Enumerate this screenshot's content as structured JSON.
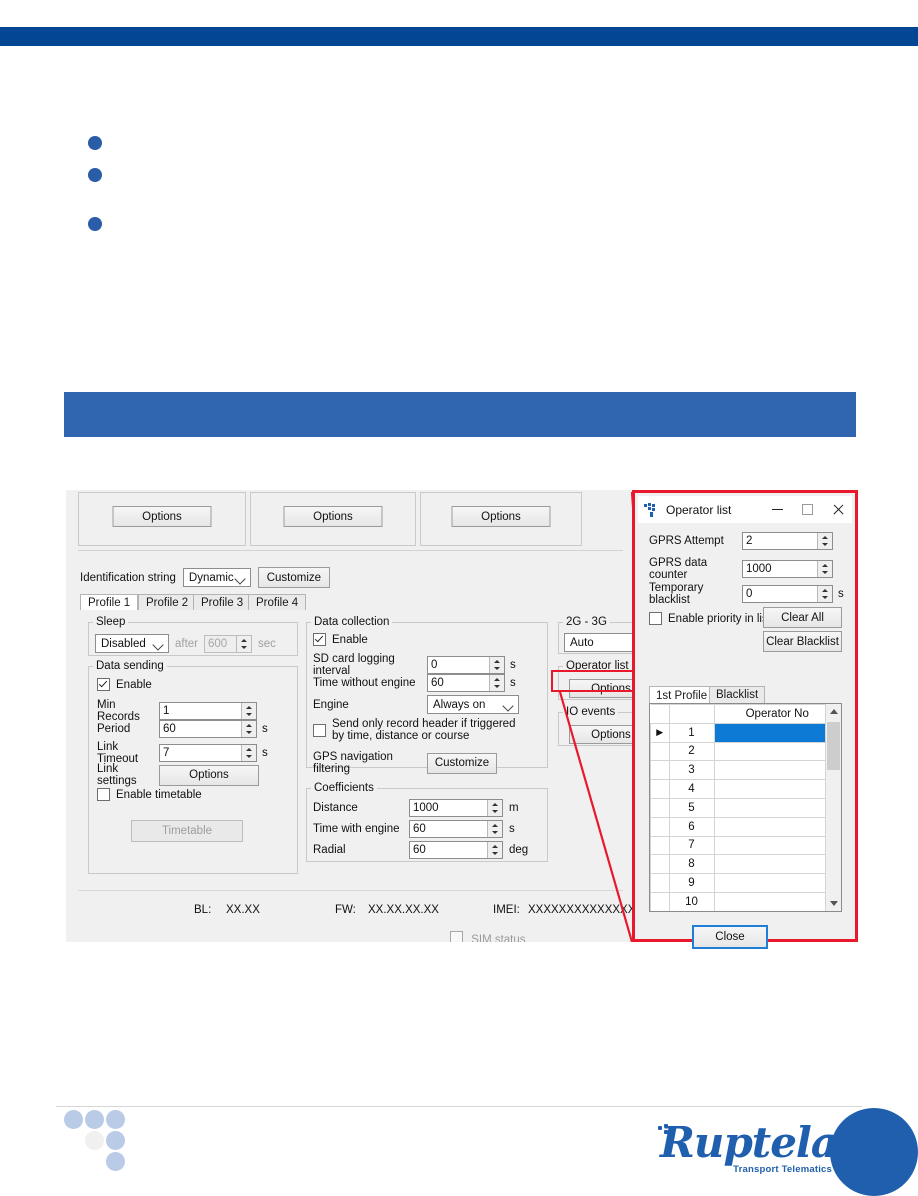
{
  "page": {
    "header_bar_color": "#034694",
    "heading_band_color": "#3065b0",
    "bullet_color": "#2a5ca8",
    "brand_name": "Ruptela",
    "brand_tagline": "Transport Telematics"
  },
  "app": {
    "top_panels": [
      {
        "button_label": "Options"
      },
      {
        "button_label": "Options"
      },
      {
        "button_label": "Options"
      }
    ],
    "identification": {
      "label": "Identification string",
      "value": "Dynamic",
      "customize_label": "Customize"
    },
    "profile_tabs": [
      {
        "label": "Profile 1",
        "active": true
      },
      {
        "label": "Profile 2",
        "active": false
      },
      {
        "label": "Profile 3",
        "active": false
      },
      {
        "label": "Profile 4",
        "active": false
      }
    ],
    "sleep": {
      "legend": "Sleep",
      "mode": "Disabled",
      "after_label": "after",
      "after_value": "600",
      "unit": "sec"
    },
    "data_sending": {
      "legend": "Data sending",
      "enable_label": "Enable",
      "enable_checked": true,
      "min_records_label": "Min Records",
      "min_records_value": "1",
      "period_label": "Period",
      "period_value": "60",
      "period_unit": "s",
      "link_timeout_label": "Link Timeout",
      "link_timeout_value": "7",
      "link_timeout_unit": "s",
      "link_settings_label": "Link settings",
      "link_settings_button": "Options",
      "enable_timetable_label": "Enable timetable",
      "enable_timetable_checked": false,
      "timetable_button": "Timetable"
    },
    "data_collection": {
      "legend": "Data collection",
      "enable_label": "Enable",
      "enable_checked": true,
      "sd_label": "SD card logging interval",
      "sd_value": "0",
      "sd_unit": "s",
      "twe_label": "Time without engine",
      "twe_value": "60",
      "twe_unit": "s",
      "engine_label": "Engine",
      "engine_value": "Always on",
      "header_only_label": "Send only record header if triggered by time, distance or course",
      "header_only_checked": false,
      "gps_filter_label": "GPS navigation filtering",
      "gps_filter_button": "Customize"
    },
    "coefficients": {
      "legend": "Coefficients",
      "rows": [
        {
          "label": "Distance",
          "value": "1000",
          "unit": "m"
        },
        {
          "label": "Time with engine",
          "value": "60",
          "unit": "s"
        },
        {
          "label": "Radial",
          "value": "60",
          "unit": "deg"
        }
      ]
    },
    "network": {
      "legend": "2G - 3G",
      "value": "Auto"
    },
    "operator_list_group": {
      "legend": "Operator list",
      "button_label": "Options",
      "highlight_color": "#e8192c"
    },
    "io_events_group": {
      "legend": "IO events",
      "button_label": "Options"
    },
    "status_bar": {
      "bl_label": "BL:",
      "bl_value": "XX.XX",
      "fw_label": "FW:",
      "fw_value": "XX.XX.XX.XX",
      "imei_label": "IMEI:",
      "imei_value": "XXXXXXXXXXXXXXX",
      "cut_off_label": "SIM status"
    }
  },
  "dialog": {
    "title": "Operator list",
    "icon": "ruptela-dots-icon",
    "window_buttons": {
      "minimize": "minimize-icon",
      "maximize": "maximize-icon",
      "close": "close-icon"
    },
    "fields": [
      {
        "label": "GPRS Attempt",
        "value": "2",
        "unit": ""
      },
      {
        "label": "GPRS data counter",
        "value": "1000",
        "unit": ""
      },
      {
        "label": "Temporary blacklist",
        "value": "0",
        "unit": "s"
      }
    ],
    "priority_checkbox": {
      "label": "Enable priority in list",
      "checked": false
    },
    "clear_all_button": "Clear All",
    "clear_blacklist_button": "Clear Blacklist",
    "tabs": [
      {
        "label": "1st Profile",
        "active": true
      },
      {
        "label": "Blacklist",
        "active": false
      }
    ],
    "table": {
      "columns": [
        "",
        "",
        "Operator No"
      ],
      "rows": [
        {
          "marker": "▶",
          "index": "1",
          "operator_no": "",
          "selected": true
        },
        {
          "marker": "",
          "index": "2",
          "operator_no": "",
          "selected": false
        },
        {
          "marker": "",
          "index": "3",
          "operator_no": "",
          "selected": false
        },
        {
          "marker": "",
          "index": "4",
          "operator_no": "",
          "selected": false
        },
        {
          "marker": "",
          "index": "5",
          "operator_no": "",
          "selected": false
        },
        {
          "marker": "",
          "index": "6",
          "operator_no": "",
          "selected": false
        },
        {
          "marker": "",
          "index": "7",
          "operator_no": "",
          "selected": false
        },
        {
          "marker": "",
          "index": "8",
          "operator_no": "",
          "selected": false
        },
        {
          "marker": "",
          "index": "9",
          "operator_no": "",
          "selected": false
        },
        {
          "marker": "",
          "index": "10",
          "operator_no": "",
          "selected": false
        }
      ],
      "selection_color": "#0d7ad6"
    },
    "close_button": "Close"
  }
}
